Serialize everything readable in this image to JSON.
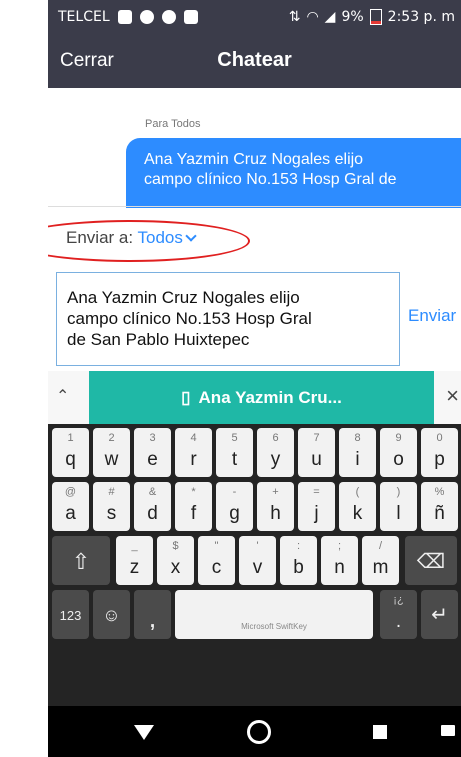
{
  "status_bar": {
    "carrier": "TELCEL",
    "battery": "9%",
    "time": "2:53 p. m"
  },
  "header": {
    "close_label": "Cerrar",
    "title": "Chatear"
  },
  "chat": {
    "recipient_label": "Para Todos",
    "message_lines": [
      "Ana Yazmin Cruz Nogales elijo",
      "campo clínico No.153 Hosp Gral de"
    ]
  },
  "send_to": {
    "label": "Enviar a:",
    "value": "Todos"
  },
  "composer": {
    "text_lines": [
      "Ana Yazmin Cruz Nogales elijo",
      "campo clínico No.153 Hosp Gral",
      "de San Pablo Huixtepec"
    ],
    "send_label": "Enviar"
  },
  "keyboard": {
    "suggestion": "Ana Yazmin Cru...",
    "row1": [
      {
        "pri": "q",
        "sec": "1"
      },
      {
        "pri": "w",
        "sec": "2"
      },
      {
        "pri": "e",
        "sec": "3"
      },
      {
        "pri": "r",
        "sec": "4"
      },
      {
        "pri": "t",
        "sec": "5"
      },
      {
        "pri": "y",
        "sec": "6"
      },
      {
        "pri": "u",
        "sec": "7"
      },
      {
        "pri": "i",
        "sec": "8"
      },
      {
        "pri": "o",
        "sec": "9"
      },
      {
        "pri": "p",
        "sec": "0"
      }
    ],
    "row2": [
      {
        "pri": "a",
        "sec": "@"
      },
      {
        "pri": "s",
        "sec": "#"
      },
      {
        "pri": "d",
        "sec": "&"
      },
      {
        "pri": "f",
        "sec": "*"
      },
      {
        "pri": "g",
        "sec": "-"
      },
      {
        "pri": "h",
        "sec": "+"
      },
      {
        "pri": "j",
        "sec": "="
      },
      {
        "pri": "k",
        "sec": "("
      },
      {
        "pri": "l",
        "sec": ")"
      },
      {
        "pri": "ñ",
        "sec": "%"
      }
    ],
    "row3": [
      {
        "pri": "z",
        "sec": "_"
      },
      {
        "pri": "x",
        "sec": "$"
      },
      {
        "pri": "c",
        "sec": "\""
      },
      {
        "pri": "v",
        "sec": "'"
      },
      {
        "pri": "b",
        "sec": ":"
      },
      {
        "pri": "n",
        "sec": ";"
      },
      {
        "pri": "m",
        "sec": "/"
      }
    ],
    "numbers_label": "123",
    "comma": ",",
    "space_brand": "Microsoft SwiftKey",
    "period": ".",
    "period_sec": "¡¿"
  },
  "colors": {
    "accent": "#2d8cff",
    "header_bg": "#3b3c4a",
    "suggestion_bg": "#1fb8a6",
    "highlight": "#e02020"
  }
}
